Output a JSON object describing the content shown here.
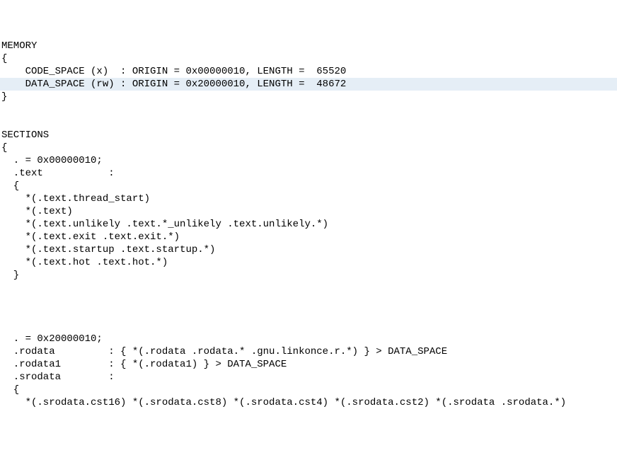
{
  "lines": [
    {
      "text": "MEMORY",
      "hl": false
    },
    {
      "text": "{",
      "hl": false
    },
    {
      "text": "    CODE_SPACE (x)  : ORIGIN = 0x00000010, LENGTH =  65520",
      "hl": false
    },
    {
      "text": "    DATA_SPACE (rw) : ORIGIN = 0x20000010, LENGTH =  48672",
      "hl": true
    },
    {
      "text": "}",
      "hl": false
    },
    {
      "text": "",
      "hl": false
    },
    {
      "text": "",
      "hl": false
    },
    {
      "text": "SECTIONS",
      "hl": false
    },
    {
      "text": "{",
      "hl": false
    },
    {
      "text": "  . = 0x00000010;",
      "hl": false
    },
    {
      "text": "  .text           :",
      "hl": false
    },
    {
      "text": "  {",
      "hl": false
    },
    {
      "text": "    *(.text.thread_start)",
      "hl": false
    },
    {
      "text": "    *(.text)",
      "hl": false
    },
    {
      "text": "    *(.text.unlikely .text.*_unlikely .text.unlikely.*)",
      "hl": false
    },
    {
      "text": "    *(.text.exit .text.exit.*)",
      "hl": false
    },
    {
      "text": "    *(.text.startup .text.startup.*)",
      "hl": false
    },
    {
      "text": "    *(.text.hot .text.hot.*)",
      "hl": false
    },
    {
      "text": "  }",
      "hl": false
    },
    {
      "text": "",
      "hl": false
    },
    {
      "text": "",
      "hl": false
    },
    {
      "text": "",
      "hl": false
    },
    {
      "text": "",
      "hl": false
    },
    {
      "text": "  . = 0x20000010;",
      "hl": false
    },
    {
      "text": "  .rodata         : { *(.rodata .rodata.* .gnu.linkonce.r.*) } > DATA_SPACE",
      "hl": false
    },
    {
      "text": "  .rodata1        : { *(.rodata1) } > DATA_SPACE",
      "hl": false
    },
    {
      "text": "  .srodata        :",
      "hl": false
    },
    {
      "text": "  {",
      "hl": false
    },
    {
      "text": "    *(.srodata.cst16) *(.srodata.cst8) *(.srodata.cst4) *(.srodata.cst2) *(.srodata .srodata.*)",
      "hl": false
    }
  ]
}
